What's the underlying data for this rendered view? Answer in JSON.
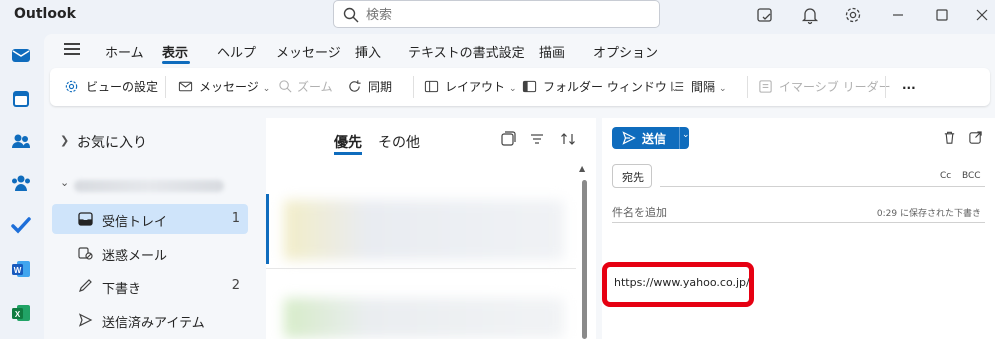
{
  "app": {
    "title": "Outlook"
  },
  "search": {
    "placeholder": "検索"
  },
  "menu": {
    "tabs": [
      {
        "label": "ホーム"
      },
      {
        "label": "表示"
      },
      {
        "label": "ヘルプ"
      },
      {
        "label": "メッセージ"
      },
      {
        "label": "挿入"
      },
      {
        "label": "テキストの書式設定"
      },
      {
        "label": "描画"
      },
      {
        "label": "オプション"
      }
    ],
    "active_tab": "表示"
  },
  "ribbon": {
    "view_settings": "ビューの設定",
    "message": "メッセージ",
    "zoom": "ズーム",
    "sync": "同期",
    "layout": "レイアウト",
    "folder_window": "フォルダー ウィンドウ",
    "spacing": "間隔",
    "immersive_reader": "イマーシブ リーダー",
    "more": "..."
  },
  "folders": {
    "favorites": "お気に入り",
    "items": [
      {
        "name": "受信トレイ",
        "count": "1"
      },
      {
        "name": "迷惑メール",
        "count": ""
      },
      {
        "name": "下書き",
        "count": "2"
      },
      {
        "name": "送信済みアイテム",
        "count": ""
      }
    ]
  },
  "message_list": {
    "tab_focused": "優先",
    "tab_other": "その他"
  },
  "compose": {
    "send_label": "送信",
    "to_label": "宛先",
    "cc_label": "Cc",
    "bcc_label": "BCC",
    "subject_placeholder": "件名を追加",
    "saved_status": "0:29 に保存された下書き",
    "body": "https://www.yahoo.co.jp/"
  },
  "colors": {
    "accent": "#0f6cbd",
    "highlight": "#e60012",
    "selected_folder": "#cfe4fa"
  }
}
